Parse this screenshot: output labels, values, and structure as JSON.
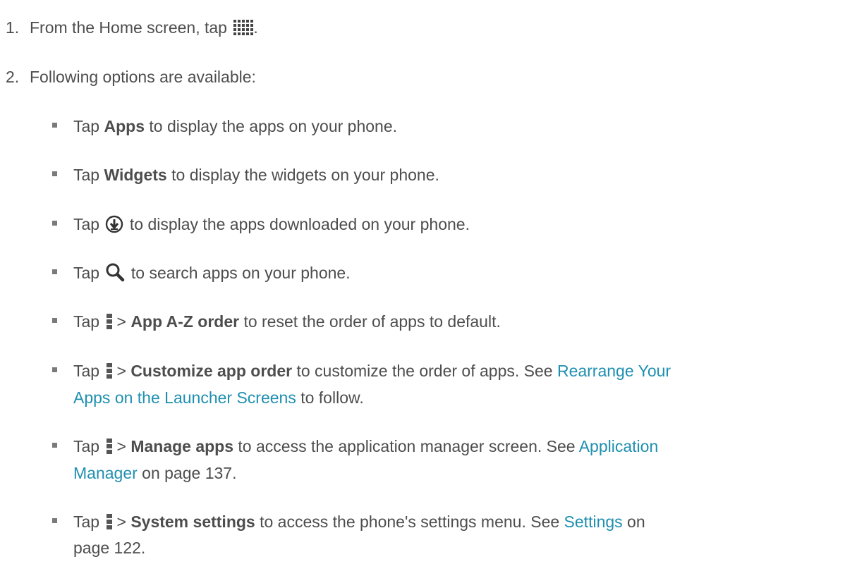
{
  "steps": [
    {
      "number": "1.",
      "text_before": "From the Home screen, tap",
      "text_after": "."
    },
    {
      "number": "2.",
      "text": "Following options are available:"
    }
  ],
  "bullets": {
    "apps": {
      "pre": "Tap",
      "bold": "Apps",
      "post": "to display the apps on your phone."
    },
    "widgets": {
      "pre": "Tap",
      "bold": "Widgets",
      "post": "to display the widgets on your phone."
    },
    "downloaded": {
      "pre": "Tap",
      "post": "to display the apps downloaded on your phone."
    },
    "search": {
      "pre": "Tap",
      "post": "to search apps on your phone."
    },
    "az": {
      "pre": "Tap",
      "gt": ">",
      "bold": "App A-Z order",
      "post": "to reset the order of apps to default."
    },
    "customize": {
      "pre": "Tap",
      "gt": ">",
      "bold": "Customize app order",
      "post": "to customize the order of apps. See",
      "link1": "Rearrange Your",
      "link2": "Apps on the Launcher Screens",
      "post2": "to follow."
    },
    "manage": {
      "pre": "Tap",
      "gt": ">",
      "bold": "Manage apps",
      "post": "to access the application manager screen. See",
      "link1": "Application",
      "link2": "Manager",
      "post2": "on page 137."
    },
    "system": {
      "pre": "Tap",
      "gt": ">",
      "bold": "System settings",
      "post": "to access the phone's settings menu. See",
      "link1": "Settings",
      "post1": "on",
      "line2": "page 122."
    }
  },
  "icons": {
    "apps_grid": "apps-grid-icon",
    "download": "download-icon",
    "search": "search-icon",
    "menu": "menu-icon"
  },
  "colors": {
    "text": "#4d4d4d",
    "link": "#1f8fb0",
    "bullet": "#7a7a7a"
  }
}
